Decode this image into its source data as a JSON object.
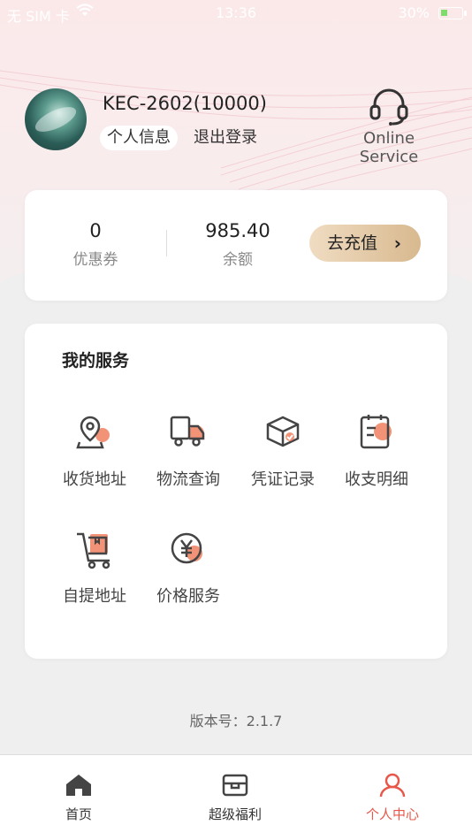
{
  "status_bar": {
    "carrier": "无 SIM 卡",
    "time": "13:36",
    "battery": "30%"
  },
  "profile": {
    "username": "KEC-2602(10000)",
    "info_button": "个人信息",
    "logout_button": "退出登录",
    "service_label_line1": "Online",
    "service_label_line2": "Service"
  },
  "wallet": {
    "coupon_value": "0",
    "coupon_label": "优惠券",
    "balance_value": "985.40",
    "balance_label": "余额",
    "recharge_button": "去充值"
  },
  "services": {
    "title": "我的服务",
    "items": [
      {
        "label": "收货地址",
        "icon": "location-pin-icon"
      },
      {
        "label": "物流查询",
        "icon": "truck-icon"
      },
      {
        "label": "凭证记录",
        "icon": "box-check-icon"
      },
      {
        "label": "收支明细",
        "icon": "calendar-icon"
      },
      {
        "label": "自提地址",
        "icon": "cart-icon"
      },
      {
        "label": "价格服务",
        "icon": "yuan-coin-icon"
      }
    ]
  },
  "version": "版本号：2.1.7",
  "tabbar": {
    "tabs": [
      {
        "label": "首页",
        "icon": "home-icon"
      },
      {
        "label": "超级福利",
        "icon": "wallet-icon"
      },
      {
        "label": "个人中心",
        "icon": "person-icon"
      }
    ],
    "active_color": "#e8574a"
  },
  "colors": {
    "accent": "#f0805f",
    "recharge_gradient_start": "#f0dcc2",
    "recharge_gradient_end": "#d8b98f"
  }
}
